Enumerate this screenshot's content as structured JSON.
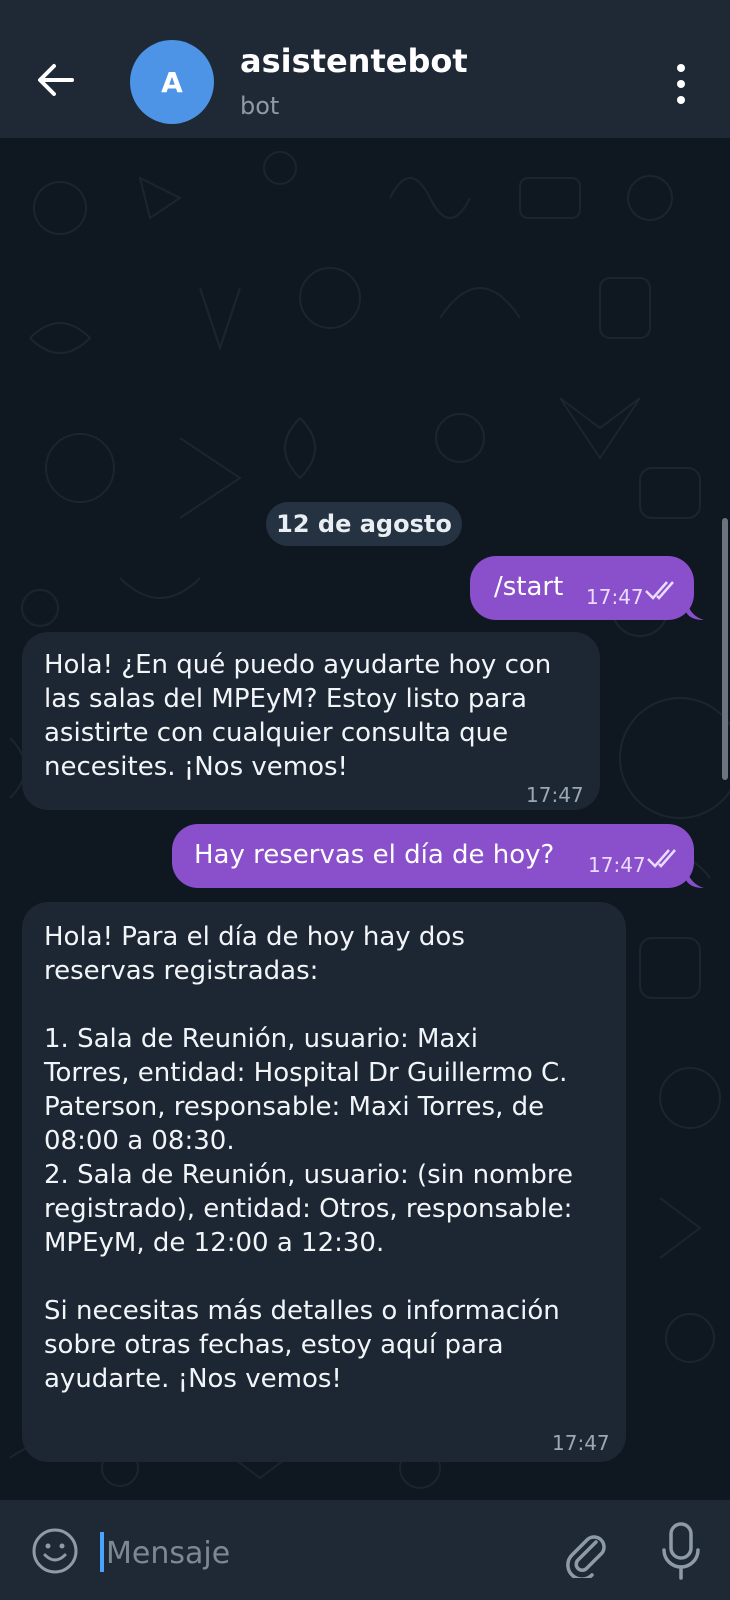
{
  "header": {
    "avatar_letter": "A",
    "title": "asistentebot",
    "subtitle": "bot",
    "accent": "#4d93e6"
  },
  "chat": {
    "date_label": "12 de agosto",
    "messages": [
      {
        "direction": "out",
        "text": "/start",
        "time": "17:47"
      },
      {
        "direction": "in",
        "text": "Hola! ¿En qué puedo ayudarte hoy con\nlas salas del MPEyM? Estoy listo para\nasistirte con cualquier consulta que\nnecesites. ¡Nos vemos!",
        "time": "17:47"
      },
      {
        "direction": "out",
        "text": "Hay reservas el día de hoy?",
        "time": "17:47"
      },
      {
        "direction": "in",
        "text": "Hola! Para el día de hoy hay dos\nreservas registradas:\n\n1. Sala de Reunión, usuario: Maxi\nTorres, entidad: Hospital Dr Guillermo C.\nPaterson, responsable: Maxi Torres, de\n08:00 a 08:30.\n2. Sala de Reunión, usuario: (sin nombre\nregistrado), entidad: Otros, responsable:\nMPEyM, de 12:00 a 12:30.\n\nSi necesitas más detalles o información\nsobre otras fechas, estoy aquí para\nayudarte. ¡Nos vemos!",
        "time": "17:47"
      }
    ],
    "outgoing_color": "#8a4fcb",
    "incoming_color": "#1d2733"
  },
  "composer": {
    "placeholder": "Mensaje"
  }
}
